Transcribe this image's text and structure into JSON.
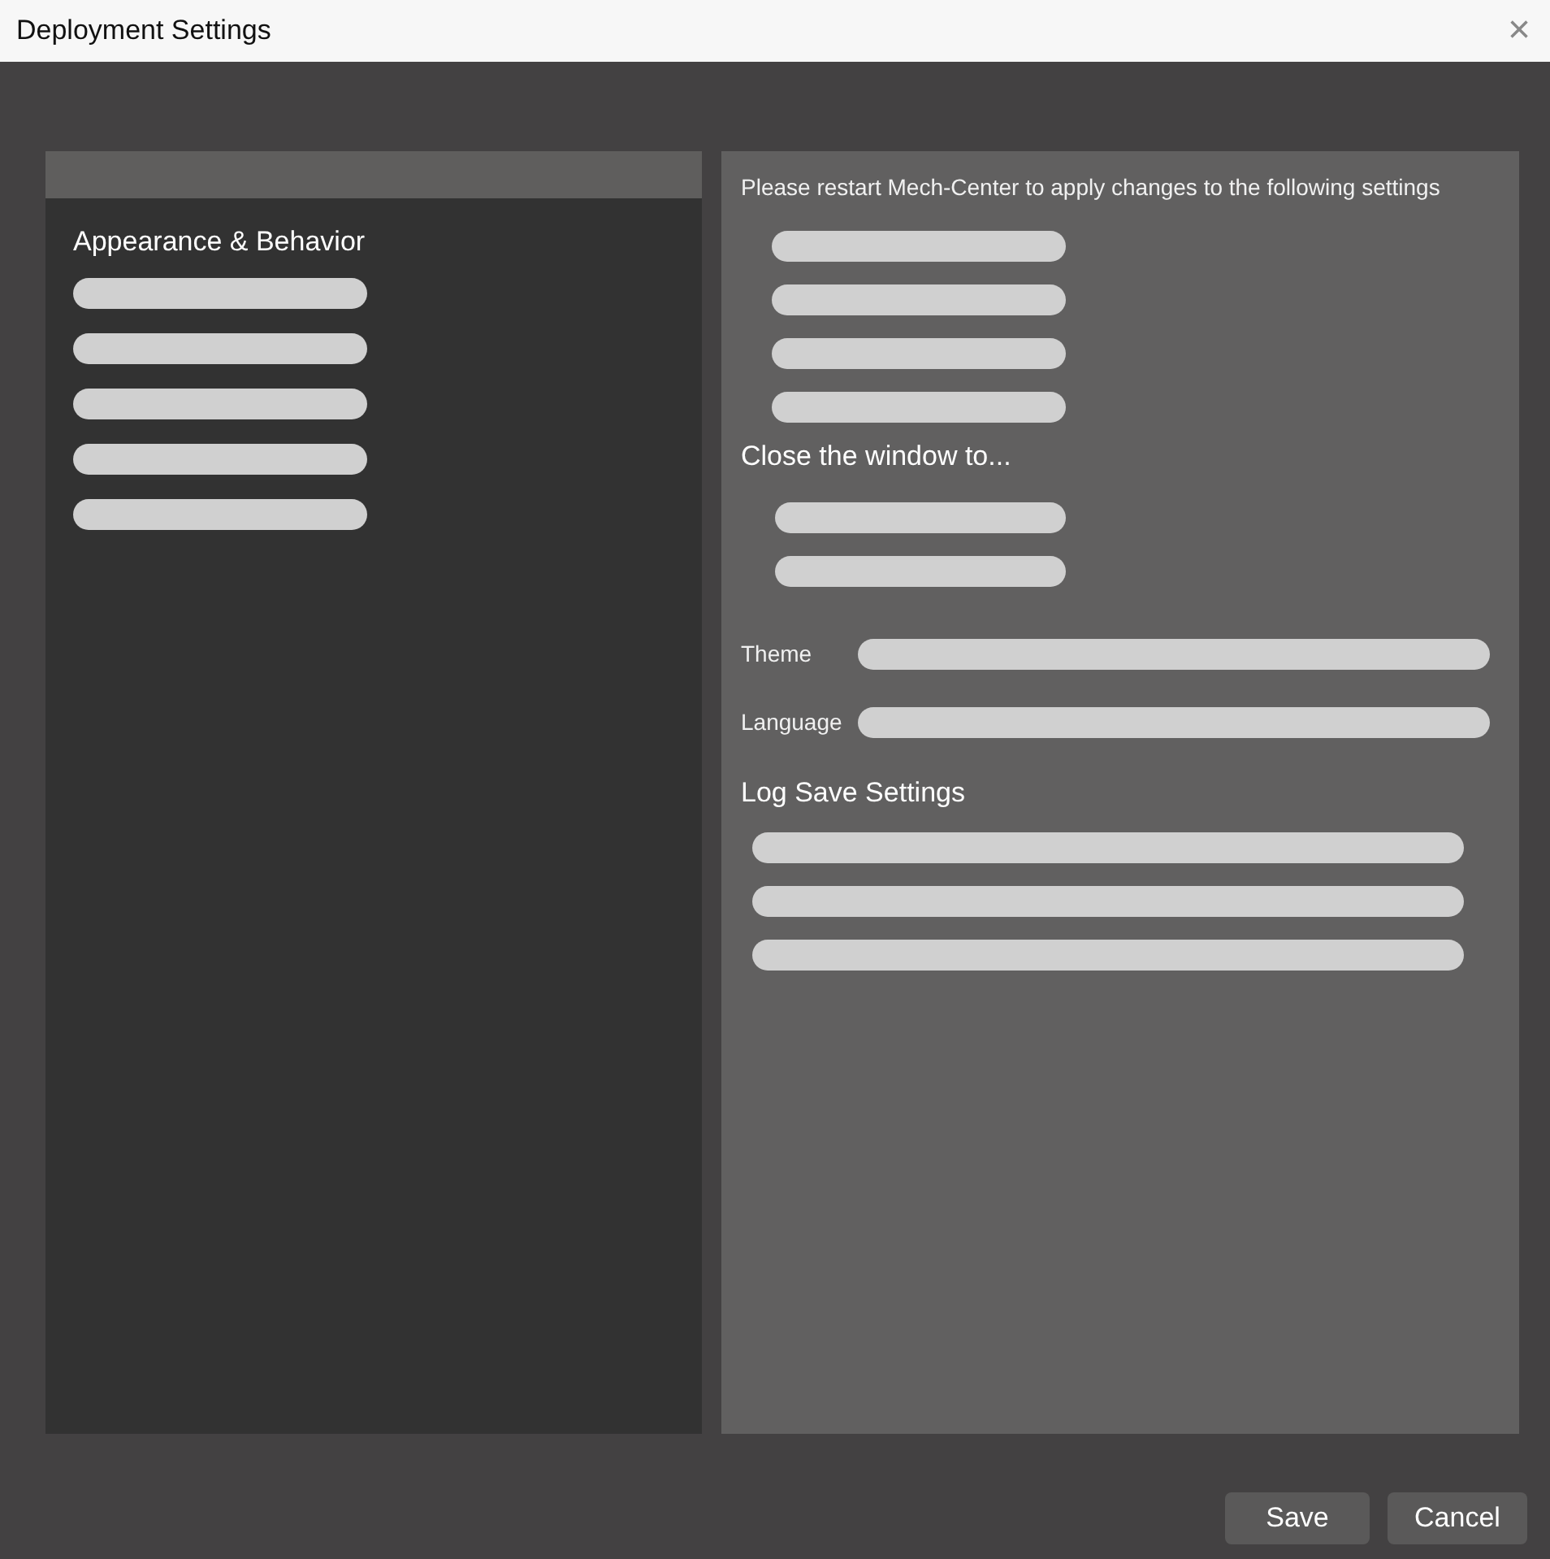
{
  "window": {
    "title": "Deployment Settings",
    "close": "×"
  },
  "sidebar": {
    "heading": "Appearance & Behavior",
    "items": [
      {
        "kind": "redacted"
      },
      {
        "kind": "redacted"
      },
      {
        "kind": "redacted"
      },
      {
        "kind": "redacted"
      },
      {
        "kind": "redacted"
      }
    ]
  },
  "settings": {
    "notice": "Please restart Mech-Center to apply changes to the following settings",
    "restart_items": [
      {
        "kind": "redacted"
      },
      {
        "kind": "redacted"
      },
      {
        "kind": "redacted"
      },
      {
        "kind": "redacted"
      }
    ],
    "close_heading": "Close the window to...",
    "close_options": [
      {
        "kind": "redacted"
      },
      {
        "kind": "redacted"
      }
    ],
    "fields": [
      {
        "label": "Theme",
        "kind": "redacted"
      },
      {
        "label": "Language",
        "kind": "redacted"
      }
    ],
    "log_heading": "Log Save Settings",
    "log_items": [
      {
        "kind": "redacted"
      },
      {
        "kind": "redacted"
      },
      {
        "kind": "redacted"
      }
    ]
  },
  "buttons": [
    "Save",
    "Cancel"
  ]
}
